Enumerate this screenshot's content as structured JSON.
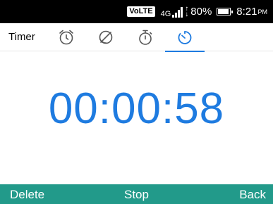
{
  "status_bar": {
    "volte": "VoLTE",
    "network": "4G",
    "battery_percent": "80%",
    "battery_level": 0.8,
    "time": "8:21",
    "ampm": "PM"
  },
  "tabs": {
    "title": "Timer",
    "items": [
      {
        "icon": "alarm-clock-icon",
        "active": false
      },
      {
        "icon": "world-clock-icon",
        "active": false
      },
      {
        "icon": "stopwatch-icon",
        "active": false
      },
      {
        "icon": "countdown-timer-icon",
        "active": true
      }
    ],
    "accent": "#1e7be0"
  },
  "timer": {
    "value": "00:00:58",
    "color": "#1e7be0"
  },
  "softkeys": {
    "left": "Delete",
    "center": "Stop",
    "right": "Back",
    "background": "#229a8a"
  }
}
